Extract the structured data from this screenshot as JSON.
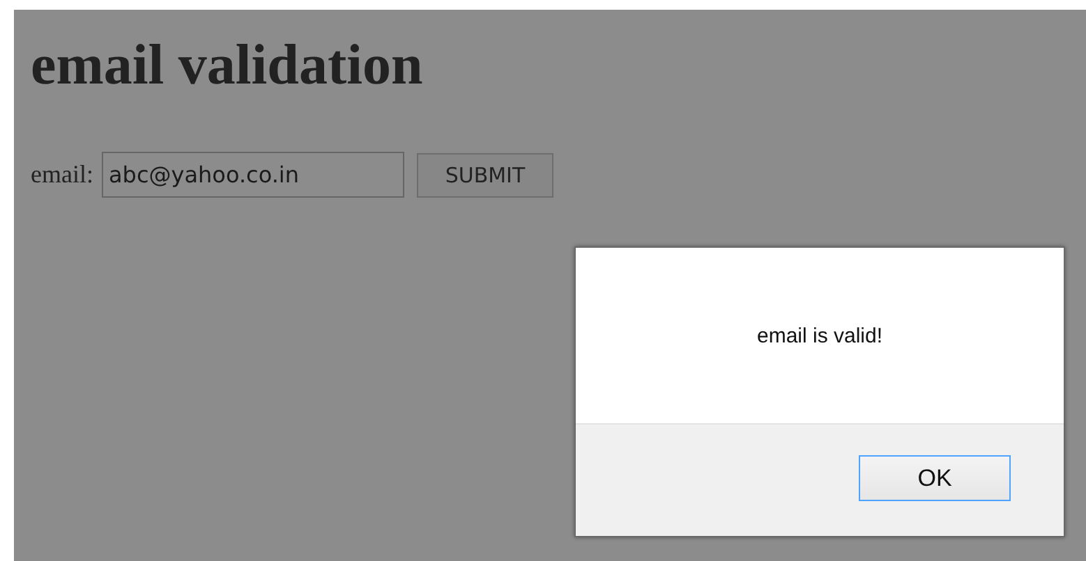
{
  "heading": "email validation",
  "form": {
    "label": "email:",
    "value": "abc@yahoo.co.in",
    "button": "SUBMIT"
  },
  "dialog": {
    "message": "email is valid!",
    "button": "OK"
  }
}
